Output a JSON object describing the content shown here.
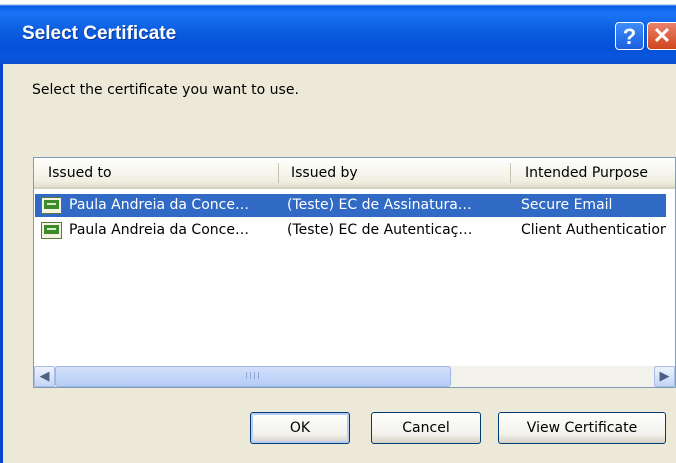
{
  "window": {
    "title": "Select Certificate",
    "help_label": "?",
    "close_label": "✕"
  },
  "instruction": "Select the certificate you want to use.",
  "list": {
    "columns": [
      "Issued to",
      "Issued by",
      "Intended Purpose"
    ],
    "rows": [
      {
        "issued_to": "Paula Andreia da Conce…",
        "issued_by": "(Teste) EC de Assinatura…",
        "purpose": "Secure Email",
        "selected": true
      },
      {
        "issued_to": "Paula Andreia da Conce…",
        "issued_by": "(Teste) EC de Autenticaç…",
        "purpose": "Client Authentication",
        "selected": false
      }
    ],
    "scroll_left_label": "◀",
    "scroll_right_label": "▶",
    "thumb_grip": "IIII"
  },
  "buttons": {
    "ok": "OK",
    "cancel": "Cancel",
    "view_certificate": "View Certificate"
  },
  "colors": {
    "titlebar": "#0a56dd",
    "selection": "#316ac5",
    "dialog_background": "#ece9d8"
  }
}
